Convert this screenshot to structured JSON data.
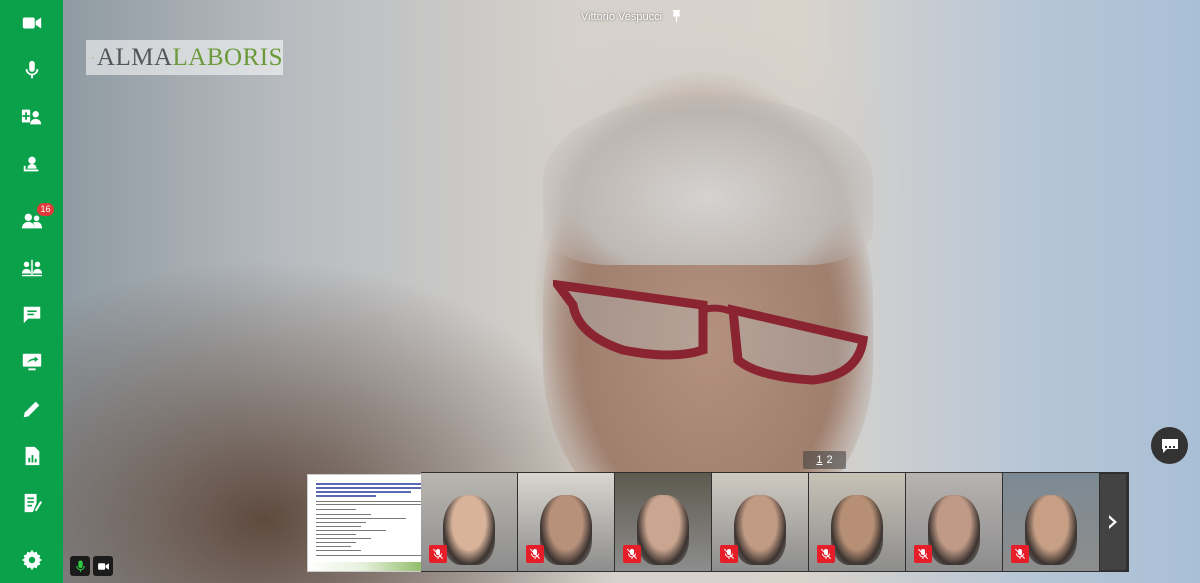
{
  "app": {
    "accent_color": "#0aa14a"
  },
  "sidebar": {
    "items": [
      {
        "id": "camera",
        "icon": "video-camera-icon"
      },
      {
        "id": "microphone",
        "icon": "microphone-icon"
      },
      {
        "id": "add-users",
        "icon": "add-users-icon"
      },
      {
        "id": "presenter",
        "icon": "presenter-icon"
      },
      {
        "id": "participants",
        "icon": "participants-icon",
        "badge": "16"
      },
      {
        "id": "breakout",
        "icon": "breakout-icon"
      },
      {
        "id": "chat",
        "icon": "chat-icon"
      },
      {
        "id": "screen-share",
        "icon": "screen-share-icon"
      },
      {
        "id": "whiteboard",
        "icon": "pencil-icon"
      },
      {
        "id": "reports",
        "icon": "report-icon"
      },
      {
        "id": "notes",
        "icon": "notes-icon"
      },
      {
        "id": "settings",
        "icon": "gear-icon"
      }
    ]
  },
  "stage": {
    "speaker_name": "Vittorio Vespucci",
    "pin_icon": "pin-icon",
    "logo": {
      "part1": "ALMA",
      "part2": "LABORIS"
    },
    "pager": {
      "page1": "1",
      "page2": "2",
      "current": "1"
    },
    "chat_button_icon": "chat-bubble-icon"
  },
  "strip": {
    "slide_icon": "slide-thumbnail",
    "tiles": [
      {
        "name": "participant-1",
        "bg": "#b9b6b0",
        "skin": "#d8b39a",
        "muted": true
      },
      {
        "name": "participant-2",
        "bg": "#d9d6cf",
        "skin": "#b8917b",
        "muted": true
      },
      {
        "name": "participant-3",
        "bg": "#5d5a4e",
        "skin": "#caa58f",
        "muted": true
      },
      {
        "name": "participant-4",
        "bg": "#cfcac2",
        "skin": "#c29b84",
        "muted": true
      },
      {
        "name": "participant-5",
        "bg": "#c8c2b6",
        "skin": "#b78f74",
        "muted": true
      },
      {
        "name": "participant-6",
        "bg": "#b7b3b2",
        "skin": "#c09a86",
        "muted": true
      },
      {
        "name": "participant-7",
        "bg": "#7c8a93",
        "skin": "#c79f85",
        "muted": true
      }
    ],
    "next_icon": "chevron-right-icon"
  },
  "self_controls": {
    "mic_icon": "microphone-icon",
    "camera_icon": "video-camera-icon"
  }
}
